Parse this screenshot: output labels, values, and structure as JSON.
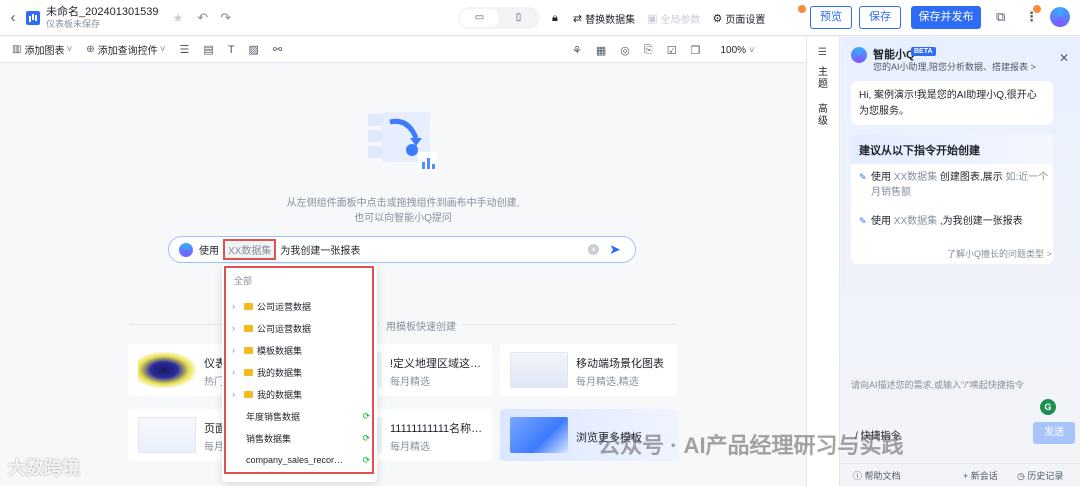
{
  "header": {
    "title": "未命名_202401301539",
    "subtitle": "仪表板未保存",
    "device_desktop": "▭",
    "device_mobile": "▯",
    "replace_dataset": "替换数据集",
    "global_params": "全局参数",
    "page_settings": "页面设置",
    "preview": "预览",
    "save": "保存",
    "save_publish": "保存并发布"
  },
  "toolbar": {
    "add_chart": "添加图表",
    "add_query_control": "添加查询控件",
    "zoom": "100%"
  },
  "side_tabs": {
    "theme": "主题",
    "advanced": "高级"
  },
  "canvas": {
    "hint_line1": "从左侧组件面板中点击或拖拽组件到画布中手动创建,",
    "hint_line2": "也可以向智能小Q提问",
    "ask": {
      "prefix": "使用",
      "chip": "XX数据集",
      "suffix": "为我创建一张报表"
    },
    "template_divider": "用模板快速创建",
    "cards": [
      {
        "title": "仪表",
        "sub": "热门"
      },
      {
        "title": "!定义地理区域这…",
        "sub": "每月精选"
      },
      {
        "title": "移动端场景化图表",
        "sub": "每月精选,精选"
      },
      {
        "title": "页面",
        "sub": "每月"
      },
      {
        "title": "11111111111名称…",
        "sub": "每月精选"
      },
      {
        "title": "浏览更多模板",
        "sub": ""
      }
    ]
  },
  "dropdown": {
    "header": "全部",
    "folders": [
      "公司运营数据",
      "公司运营数据",
      "模板数据集",
      "我的数据集",
      "我的数据集"
    ],
    "datasets": [
      "年度销售数据",
      "销售数据集",
      "company_sales_recor…"
    ]
  },
  "ai": {
    "name": "智能小Q",
    "badge": "BETA",
    "desc": "您的AI小助理,陪您分析数据、搭建报表 >",
    "greeting": "Hi, 案例演示!我是您的AI助理小Q,很开心为您服务。",
    "suggest_title": "建议从以下指令开始创建",
    "s1_a": "使用 ",
    "s1_b": "XX数据集",
    "s1_c": " 创建图表,展示 ",
    "s1_d": "如:近一个月销售额",
    "s2_a": "使用 ",
    "s2_b": "XX数据集",
    "s2_c": " ,为我创建一张报表",
    "more": "了解小Q擅长的问题类型 >",
    "input_placeholder": "请向AI描述您的需求,或输入\"/\"唤起快捷指令",
    "quick": "快捷指令",
    "send": "发送",
    "help": "帮助文档",
    "new_chat": "新会话",
    "history": "历史记录"
  },
  "watermark": {
    "left": "大数跨境",
    "right": "公众号 · AI产品经理研习与实践"
  },
  "colors": {
    "accent": "#2f6cf6",
    "highlight_frame": "#e05252",
    "folder": "#f7ba1e",
    "dataset_icon": "#00b42a"
  }
}
